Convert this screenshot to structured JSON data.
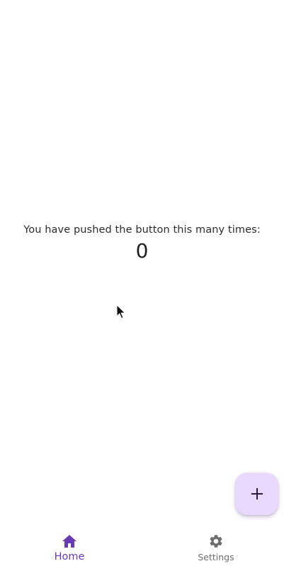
{
  "counter": {
    "message": "You have pushed the button this many times:",
    "value": "0"
  },
  "fab": {
    "icon": "plus-icon",
    "color": "#ead9ff",
    "icon_color": "#2a1a44"
  },
  "bottom_nav": {
    "items": [
      {
        "label": "Home",
        "icon": "home-icon",
        "selected": true,
        "color": "#6a3bb7"
      },
      {
        "label": "Settings",
        "icon": "gear-icon",
        "selected": false,
        "color": "#6e6e6e"
      }
    ]
  }
}
